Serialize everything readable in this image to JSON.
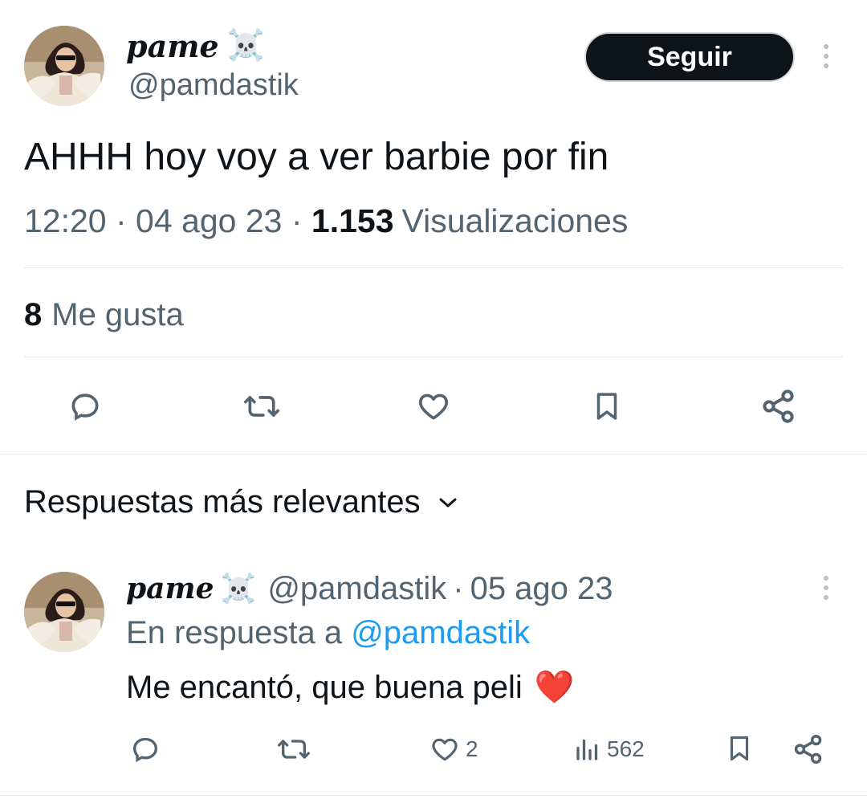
{
  "tweet": {
    "display_name": "pame",
    "name_emoji": "☠️",
    "handle": "@pamdastik",
    "follow_label": "Seguir",
    "text": "AHHH hoy voy a ver barbie por fin",
    "time": "12:20",
    "sep1": " · ",
    "date": "04 ago 23",
    "sep2": " · ",
    "views_count": "1.153",
    "views_label": "Visualizaciones",
    "likes_count": "8",
    "likes_label": "Me gusta",
    "actions": [
      "reply-icon",
      "retweet-icon",
      "like-icon",
      "bookmark-icon",
      "share-icon"
    ]
  },
  "replies_section": {
    "sort_label": "Respuestas más relevantes"
  },
  "reply": {
    "display_name": "pame",
    "name_emoji": "☠️",
    "handle": "@pamdastik",
    "sep": " · ",
    "date": "05 ago 23",
    "in_reply_prefix": "En respuesta a",
    "in_reply_handle": "@pamdastik",
    "text": "Me encantó, que buena peli",
    "text_emoji": "❤️",
    "likes": "2",
    "views": "562"
  },
  "colors": {
    "text": "#0f1419",
    "secondary": "#536471",
    "link": "#1d9bf0",
    "divider": "#e6e9eb",
    "heart_emoji": "#e0245e"
  }
}
